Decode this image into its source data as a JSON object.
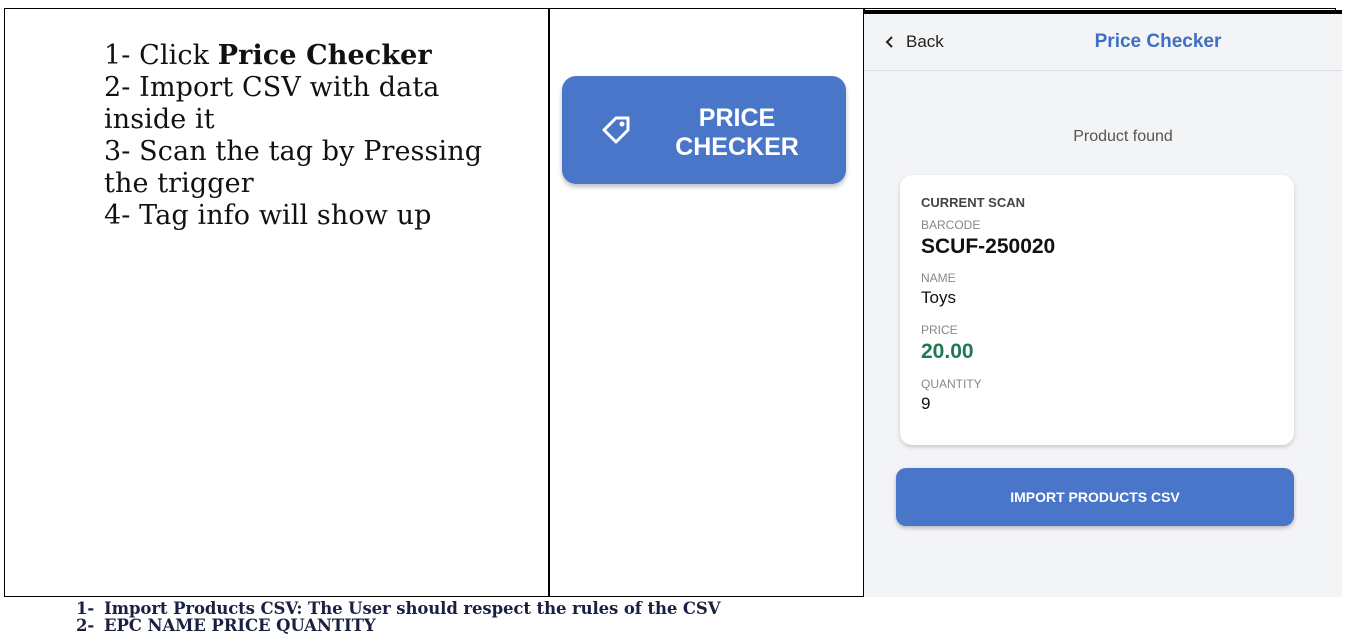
{
  "instructions": {
    "step1_prefix": "1- Click ",
    "step1_bold": "Price Checker",
    "step2a": "2- Import CSV with data",
    "step2b": "inside it",
    "step3a": "3- Scan the tag by Pressing",
    "step3b": "the trigger",
    "step4": "4- Tag info will show up"
  },
  "price_checker_button": {
    "line1": "PRICE",
    "line2": "CHECKER",
    "icon": "tag-icon"
  },
  "phone": {
    "back_label": "Back",
    "title": "Price Checker",
    "status": "Product found",
    "card": {
      "heading": "CURRENT SCAN",
      "barcode_label": "BARCODE",
      "barcode_value": "SCUF-250020",
      "name_label": "NAME",
      "name_value": "Toys",
      "price_label": "PRICE",
      "price_value": "20.00",
      "quantity_label": "QUANTITY",
      "quantity_value": "9"
    },
    "import_button": "IMPORT PRODUCTS CSV"
  },
  "notes": [
    {
      "num": "1-",
      "text": "Import Products CSV: The User should respect the rules of the CSV"
    },
    {
      "num": "2-",
      "text": "EPC NAME PRICE QUANTITY"
    }
  ],
  "colors": {
    "accent": "#4a76c9",
    "title_blue": "#3f6fc2",
    "price_green": "#1f7a54"
  }
}
